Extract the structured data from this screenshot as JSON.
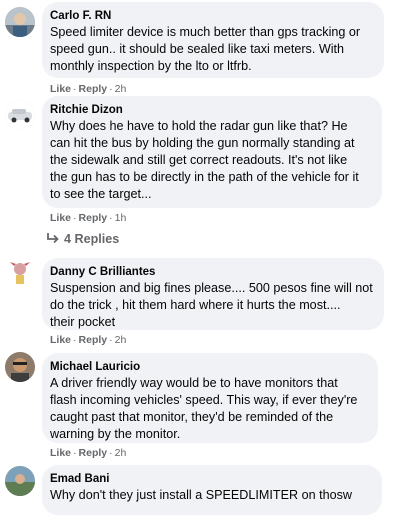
{
  "comments": [
    {
      "author": "Carlo F. RN",
      "text": "Speed limiter device is much better than gps tracking or\nspeed gun.. it should be sealed like taxi meters. With\nmonthly inspection by the lto or ltfrb.",
      "like": "Like",
      "reply": "Reply",
      "time": "2h"
    },
    {
      "author": "Ritchie Dizon",
      "text": "Why does he have to hold the radar gun like that? He\ncan hit the bus by holding the gun normally standing at\nthe sidewalk and still get correct readouts. It's not like\nthe gun has to be directly in the path of the vehicle for it\nto see the target...",
      "like": "Like",
      "reply": "Reply",
      "time": "1h",
      "replies_label": "4 Replies"
    },
    {
      "author": "Danny C Brilliantes",
      "text": "Suspension and big fines please.... 500 pesos fine will not\ndo the trick , hit them hard where it hurts the most....\ntheir pocket",
      "like": "Like",
      "reply": "Reply",
      "time": "2h"
    },
    {
      "author": "Michael Lauricio",
      "text": "A driver friendly way would be to have monitors that\nflash incoming vehicles' speed. This way, if ever they're\ncaught past that monitor, they'd be reminded of the\nwarning by the monitor.",
      "like": "Like",
      "reply": "Reply",
      "time": "2h"
    },
    {
      "author": "Emad Bani",
      "text": "Why don't they just install a SPEEDLIMITER on thosw"
    }
  ],
  "separator": "·",
  "colors": {
    "bubble": "#f0f2f5",
    "secondary_text": "#65676b",
    "primary_text": "#050505"
  },
  "icons": [
    "reply-arrow-icon"
  ]
}
